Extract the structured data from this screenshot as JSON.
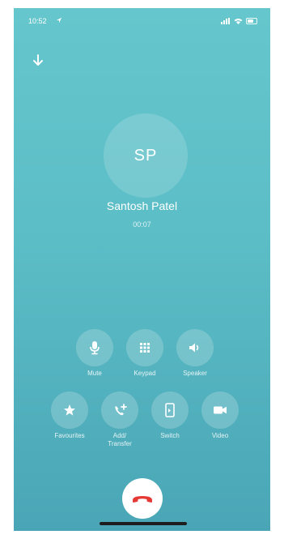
{
  "status_bar": {
    "time": "10:52"
  },
  "call": {
    "initials": "SP",
    "name": "Santosh Patel",
    "duration": "00:07"
  },
  "controls_row1": [
    {
      "label": "Mute",
      "icon": "microphone-icon"
    },
    {
      "label": "Keypad",
      "icon": "keypad-icon"
    },
    {
      "label": "Speaker",
      "icon": "speaker-icon"
    }
  ],
  "controls_row2": [
    {
      "label": "Favourites",
      "icon": "star-icon"
    },
    {
      "label": "Add/\nTransfer",
      "icon": "add-call-icon"
    },
    {
      "label": "Switch",
      "icon": "switch-device-icon"
    },
    {
      "label": "Video",
      "icon": "video-camera-icon"
    }
  ],
  "end_call": {
    "icon": "hang-up-icon",
    "color": "#e53935"
  },
  "colors": {
    "background_top": "#66c6cd",
    "background_bottom": "#4aa6b6"
  }
}
